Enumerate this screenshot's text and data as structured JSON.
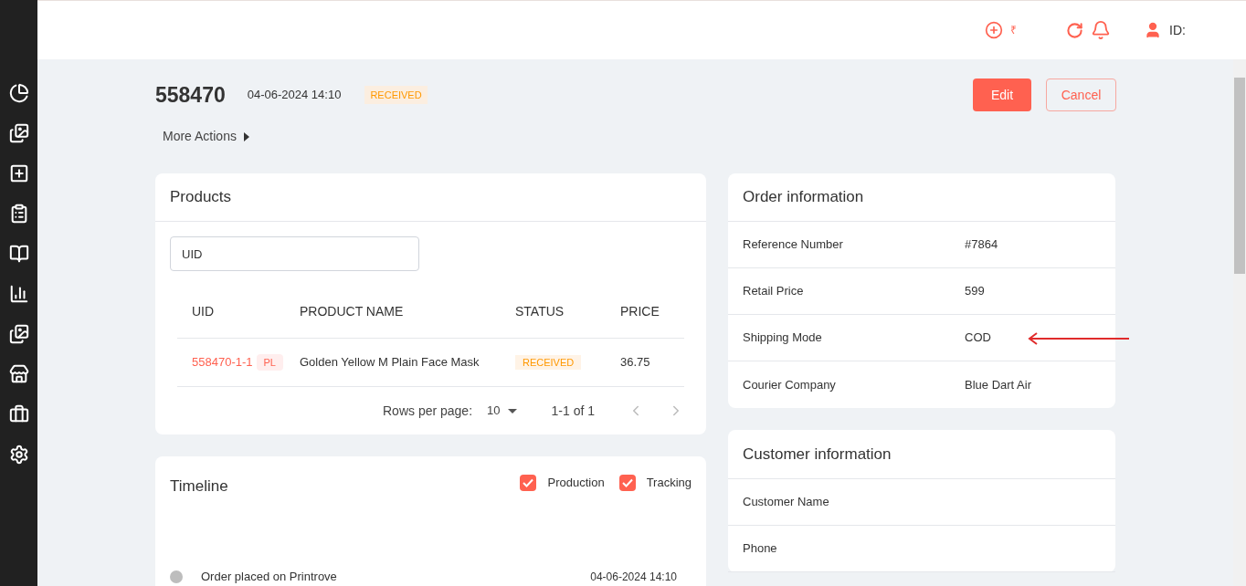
{
  "header": {
    "currency": "₹",
    "user_label": "ID:"
  },
  "order": {
    "number": "558470",
    "datetime": "04-06-2024 14:10",
    "status": "RECEIVED",
    "more_actions": "More Actions",
    "buttons": [
      {
        "kind": "primary",
        "label": "Edit"
      },
      {
        "kind": "outline",
        "label": "Cancel"
      }
    ]
  },
  "products": {
    "title": "Products",
    "search": {
      "value": "UID"
    },
    "columns": [
      "UID",
      "PRODUCT NAME",
      "STATUS",
      "PRICE"
    ],
    "rows": [
      {
        "uid": "558470-1-1",
        "tag": "PL",
        "name": "Golden Yellow M Plain Face Mask",
        "status": "RECEIVED",
        "price": "36.75"
      }
    ],
    "pagination": {
      "rows_label": "Rows per page:",
      "rows_value": "10",
      "range": "1-1 of 1"
    }
  },
  "timeline": {
    "title": "Timeline",
    "filters": [
      {
        "label": "Production",
        "checked": true
      },
      {
        "label": "Tracking",
        "checked": true
      }
    ],
    "events": [
      {
        "text": "Order placed on Printrove",
        "time": "04-06-2024 14:10"
      }
    ]
  },
  "order_information": {
    "title": "Order information",
    "fields": [
      {
        "label": "Reference Number",
        "value": "#7864",
        "annotated": false
      },
      {
        "label": "Retail Price",
        "value": "599",
        "annotated": false
      },
      {
        "label": "Shipping Mode",
        "value": "COD",
        "annotated": true
      },
      {
        "label": "Courier Company",
        "value": "Blue Dart Air",
        "annotated": false
      }
    ]
  },
  "customer_information": {
    "title": "Customer information",
    "fields": [
      {
        "label": "Customer Name"
      },
      {
        "label": "Phone"
      }
    ]
  }
}
